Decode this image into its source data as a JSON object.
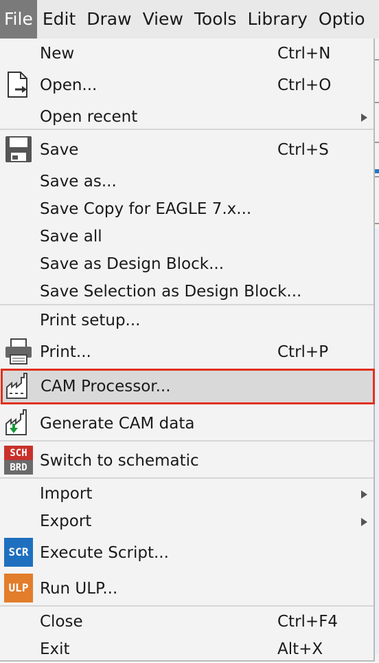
{
  "menubar": {
    "items": [
      "File",
      "Edit",
      "Draw",
      "View",
      "Tools",
      "Library",
      "Optio"
    ]
  },
  "colors": {
    "highlight_border": "#e0301e",
    "scr_badge": "#1f6fbf",
    "ulp_badge": "#e27d2b",
    "sch_badge": "#c8312b"
  },
  "file_menu": {
    "new": {
      "label": "New",
      "shortcut": "Ctrl+N"
    },
    "open": {
      "label": "Open...",
      "shortcut": "Ctrl+O",
      "icon": "open-file-icon"
    },
    "open_recent": {
      "label": "Open recent"
    },
    "save": {
      "label": "Save",
      "shortcut": "Ctrl+S",
      "icon": "floppy-disk-icon"
    },
    "save_as": {
      "label": "Save as..."
    },
    "save_copy": {
      "label": "Save Copy for EAGLE 7.x..."
    },
    "save_all": {
      "label": "Save all"
    },
    "save_design_block": {
      "label": "Save as Design Block..."
    },
    "save_selection_block": {
      "label": "Save Selection as Design Block..."
    },
    "print_setup": {
      "label": "Print setup..."
    },
    "print": {
      "label": "Print...",
      "shortcut": "Ctrl+P",
      "icon": "printer-icon"
    },
    "cam_processor": {
      "label": "CAM Processor...",
      "icon": "factory-icon"
    },
    "generate_cam": {
      "label": "Generate CAM data",
      "icon": "factory-download-icon"
    },
    "switch_schematic": {
      "label": "Switch to schematic",
      "icon": "sch-brd-icon",
      "badge_top": "SCH",
      "badge_bottom": "BRD"
    },
    "import": {
      "label": "Import"
    },
    "export": {
      "label": "Export"
    },
    "execute_script": {
      "label": "Execute Script...",
      "icon": "scr-icon",
      "badge": "SCR"
    },
    "run_ulp": {
      "label": "Run ULP...",
      "icon": "ulp-icon",
      "badge": "ULP"
    },
    "close": {
      "label": "Close",
      "shortcut": "Ctrl+F4"
    },
    "exit": {
      "label": "Exit",
      "shortcut": "Alt+X"
    }
  }
}
